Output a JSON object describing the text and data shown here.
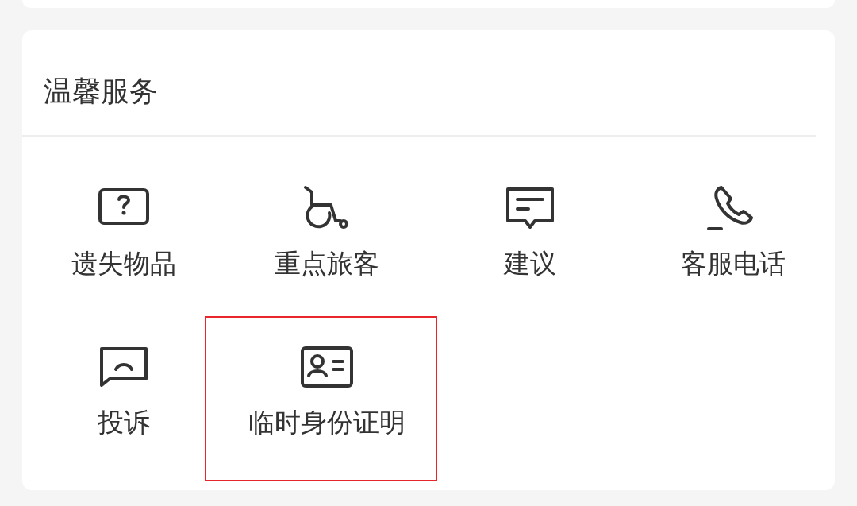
{
  "section": {
    "title": "温馨服务"
  },
  "services": [
    {
      "kind": "question",
      "label": "遗失物品",
      "highlighted": false
    },
    {
      "kind": "wheelchair",
      "label": "重点旅客",
      "highlighted": false
    },
    {
      "kind": "message",
      "label": "建议",
      "highlighted": false
    },
    {
      "kind": "phone",
      "label": "客服电话",
      "highlighted": false
    },
    {
      "kind": "complaint",
      "label": "投诉",
      "highlighted": false
    },
    {
      "kind": "idcard",
      "label": "临时身份证明",
      "highlighted": true
    }
  ]
}
